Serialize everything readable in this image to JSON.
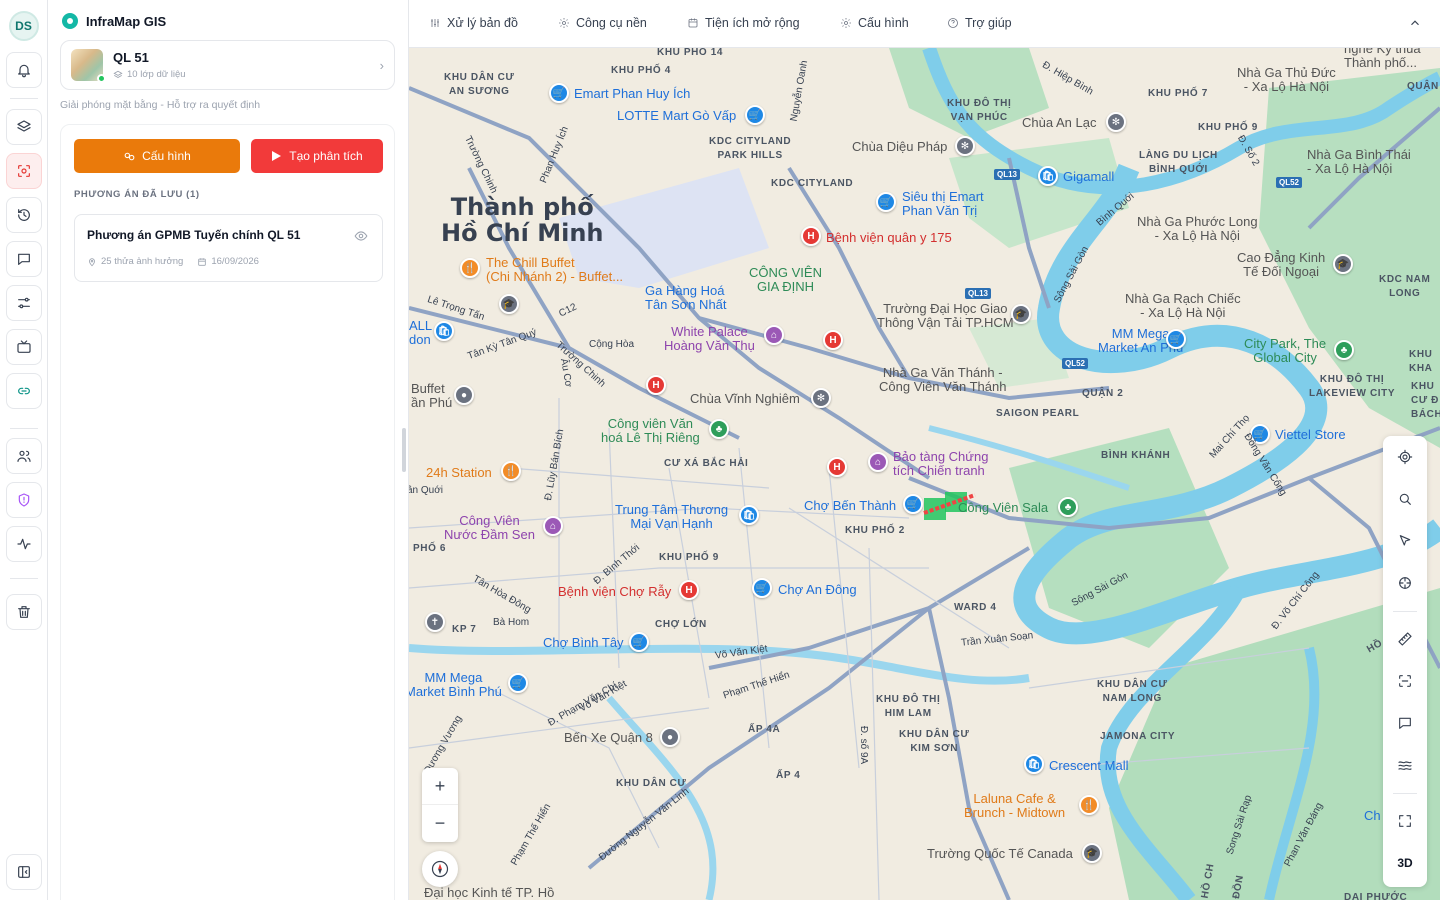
{
  "user": {
    "initials": "DS"
  },
  "app": {
    "name": "InfraMap GIS"
  },
  "project": {
    "name": "QL 51",
    "layers": "10 lớp dữ liệu",
    "tagline": "Giải phóng mặt bằng - Hỗ trợ ra quyết định"
  },
  "actions": {
    "config_label": "Cấu hình",
    "analyze_label": "Tạo phân tích"
  },
  "saved": {
    "title": "PHƯƠNG ÁN ĐÃ LƯU (1)",
    "items": [
      {
        "name": "Phương án GPMB Tuyến chính QL 51",
        "parcels": "25 thửa ảnh hưởng",
        "date": "16/09/2026"
      }
    ]
  },
  "menu": {
    "items": [
      {
        "label": "Xử lý bản đồ",
        "icon": "sliders-icon"
      },
      {
        "label": "Công cụ nền",
        "icon": "gear-icon"
      },
      {
        "label": "Tiện ích mở rộng",
        "icon": "calendar-icon"
      },
      {
        "label": "Cấu hình",
        "icon": "gear-icon"
      },
      {
        "label": "Trợ giúp",
        "icon": "help-icon"
      }
    ]
  },
  "map": {
    "city": "Thành phố\nHồ Chí Minh",
    "districts": [
      "KHU PHỐ 14",
      "KHU PHỐ 4",
      "KHU DÂN CƯ\nAN SƯƠNG",
      "KHU ĐÔ THỊ\nVẠN PHÚC",
      "KHU PHỐ 7",
      "KHU PHỐ 9",
      "KDC CITYLAND\nPARK HILLS",
      "KDC CITYLAND",
      "LÀNG DU LỊCH\nBÌNH QUỚI",
      "KDC NAM\nLONG",
      "QUẬN 2",
      "SAIGON PEARL",
      "KHU ĐÔ THỊ\nLAKEVIEW CITY",
      "BÌNH KHÁNH",
      "CƯ XÁ BẮC HẢI",
      "KHU PHỐ 2",
      "KHU PHỐ 9",
      "CHỢ LỚN",
      "WARD 4",
      "KP 7",
      "KHU ĐÔ THỊ\nHIM LAM",
      "KHU DÂN CƯ\nKIM SƠN",
      "KHU DÂN CƯ\nNAM LONG",
      "JAMONA CITY",
      "ẤP 4A",
      "ẤP 4",
      "KHU DÂN CƯ",
      "QUẬN",
      "KHU\nKHA",
      "KHU\nCƯ Đ\nBÁCH",
      "PHỐ 6"
    ],
    "pois": {
      "emart": "Emart Phan Huy Ích",
      "lotte": "LOTTE Mart Gò Vấp",
      "dieuphap": "Chùa Diệu Pháp",
      "anlac": "Chùa An Lạc",
      "gigamall": "Gigamall",
      "emart2": "Siêu thị Emart\nPhan Văn Trị",
      "bv175": "Bệnh viện quân y 175",
      "chill": "The Chill Buffet\n(Chi Nhánh 2) - Buffet...",
      "gahang": "Ga Hàng Hoá\nTân Sơn Nhất",
      "giadinh": "CÔNG VIÊN\nGIA ĐỊNH",
      "gtvt": "Trường Đại Học Giao\nThông Vận Tải TP.HCM",
      "whitepalace": "White Palace\nHoàng Văn Thụ",
      "vinhnghiem": "Chùa Vĩnh Nghiêm",
      "vanthanh": "Nhà Ga Văn Thánh -\nCông Viên Văn Thánh",
      "mmanphu": "MM Mega\nMarket An Phú",
      "citypark": "City Park, The\nGlobal City",
      "viettel": "Viettel Store",
      "lethirieng": "Công viên Văn\nhoá Lê Thị Riêng",
      "baotang": "Bảo tàng Chứng\ntích Chiến tranh",
      "chobenthanh": "Chợ Bến Thành",
      "sala": "Công Viên Sala",
      "station24": "24h Station",
      "damsen": "Công Viên\nNước Đầm Sen",
      "trungtam": "Trung Tâm Thương\nMại Vạn Hạnh",
      "bvchoray": "Bệnh viện Chợ Rẫy",
      "choandong": "Chợ An Đông",
      "chobinhtay": "Chợ Bình Tây",
      "mmbinhphu": "MM Mega\nMarket Bình Phú",
      "benxe": "Bến Xe Quận 8",
      "crescent": "Crescent Mall",
      "laluna": "Laluna Cafe &\nBrunch - Midtown",
      "canada": "Trường Quốc Tế Canada",
      "ueh": "Đại học Kinh tế TP. Hồ",
      "thuduc": "Nhà Ga Thủ Đức\n- Xa Lộ Hà Nội",
      "binhthai": "Nhà Ga Bình Thái\n- Xa Lộ Hà Nội",
      "phuoclong": "Nhà Ga Phước Long\n- Xa Lộ Hà Nội",
      "caodang": "Cao Đẳng Kinh\nTế Đối Ngoại",
      "rachchiec": "Nhà Ga Rạch Chiếc\n- Xa Lộ Hà Nội",
      "buffet": "Buffet\nần Phú",
      "all": "ALL\ndon",
      "thanhpho": "ngne Ky thua\nThành phố...",
      "cho": "Ch"
    },
    "streets": [
      "Trường Chinh",
      "Phan Huy Ích",
      "Nguyễn Oanh",
      "Lê Trọng Tấn",
      "Tân Kỳ Tân Quý",
      "C12",
      "Cộng Hòa",
      "Trường Chinh",
      "Âu Cơ",
      "Lũy Bán Bích",
      "Đ. Lũy Bán Bích",
      "Đ. Bình Thới",
      "Tân Hòa Đông",
      "Bà Hom",
      "Võ Văn Kiệt",
      "Đ. Phạm Văn Chí",
      "Võ Văn Kiệt",
      "Phạm Thế Hiển",
      "Trần Xuân Soạn",
      "Đường Nguyễn Văn Linh",
      "Phạm Thế Hiển",
      "Đ. Hiệp Bình",
      "Đ. Số 2",
      "Bình Quới",
      "Sông Sài Gòn",
      "Mai Chí Thọ",
      "Đồng Văn Cống",
      "Sông Sài Gòn",
      "Đ. Võ Chí Công",
      "Song Sài Rạp",
      "Phan Văn Đáng",
      "Đ. số 9A",
      "Đương Vương",
      "ân Quới",
      "HỒ",
      "HỒ CH",
      "ĐỒN",
      "DAI PHƯỚC"
    ],
    "shields": [
      "QL13",
      "QL13",
      "QL52",
      "QL52"
    ]
  },
  "colors": {
    "accent_orange": "#ea7a0b",
    "accent_red": "#f23a3a",
    "brand_teal": "#14b8a6",
    "water": "#7fcdea",
    "park": "#a8dcb6"
  }
}
